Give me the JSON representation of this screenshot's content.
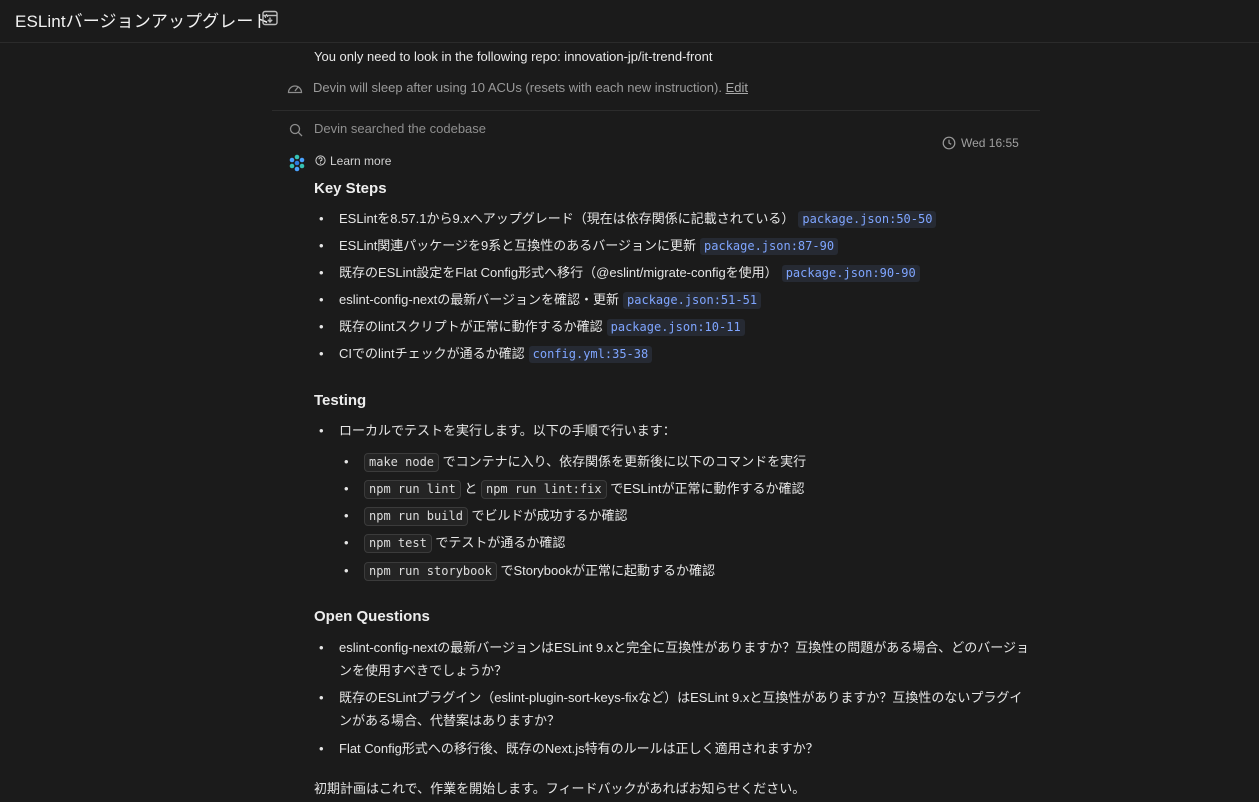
{
  "header": {
    "title": "ESLintバージョンアップグレード",
    "archive_icon": "archive-icon"
  },
  "instruction": "You only need to look in the following repo: innovation-jp/it-trend-front",
  "sleep": {
    "text": "Devin will sleep after using 10 ACUs (resets with each new instruction). ",
    "edit": "Edit"
  },
  "search": {
    "text": "Devin searched the codebase"
  },
  "timestamp": "Wed 16:55",
  "learn_more": "Learn more",
  "key_steps": {
    "heading": "Key Steps",
    "items": [
      {
        "text": "ESLintを8.57.1から9.xへアップグレード（現在は依存関係に記載されている）",
        "ref": "package.json:50-50"
      },
      {
        "text": "ESLint関連パッケージを9系と互換性のあるバージョンに更新",
        "ref": "package.json:87-90"
      },
      {
        "text": "既存のESLint設定をFlat Config形式へ移行（@eslint/migrate-configを使用）",
        "ref": "package.json:90-90"
      },
      {
        "text": "eslint-config-nextの最新バージョンを確認・更新",
        "ref": "package.json:51-51"
      },
      {
        "text": "既存のlintスクリプトが正常に動作するか確認",
        "ref": "package.json:10-11"
      },
      {
        "text": "CIでのlintチェックが通るか確認",
        "ref": "config.yml:35-38"
      }
    ]
  },
  "testing": {
    "heading": "Testing",
    "intro": "ローカルでテストを実行します。以下の手順で行います：",
    "sub": [
      {
        "code1": "make node",
        "text": "でコンテナに入り、依存関係を更新後に以下のコマンドを実行"
      },
      {
        "code1": "npm run lint",
        "mid": "と",
        "code2": "npm run lint:fix",
        "text": "でESLintが正常に動作するか確認"
      },
      {
        "code1": "npm run build",
        "text": "でビルドが成功するか確認"
      },
      {
        "code1": "npm test",
        "text": "でテストが通るか確認"
      },
      {
        "code1": "npm run storybook",
        "text": "でStorybookが正常に起動するか確認"
      }
    ]
  },
  "open_questions": {
    "heading": "Open Questions",
    "items": [
      "eslint-config-nextの最新バージョンはESLint 9.xと完全に互換性がありますか？互換性の問題がある場合、どのバージョンを使用すべきでしょうか？",
      "既存のESLintプラグイン（eslint-plugin-sort-keys-fixなど）はESLint 9.xと互換性がありますか？互換性のないプラグインがある場合、代替案はありますか？",
      "Flat Config形式への移行後、既存のNext.js特有のルールは正しく適用されますか？"
    ]
  },
  "closing": "初期計画はこれで、作業を開始します。フィードバックがあればお知らせください。",
  "colors": {
    "background": "#1b1b1b",
    "code_ref": "#7fa5ff",
    "muted": "#9a9a9a"
  }
}
